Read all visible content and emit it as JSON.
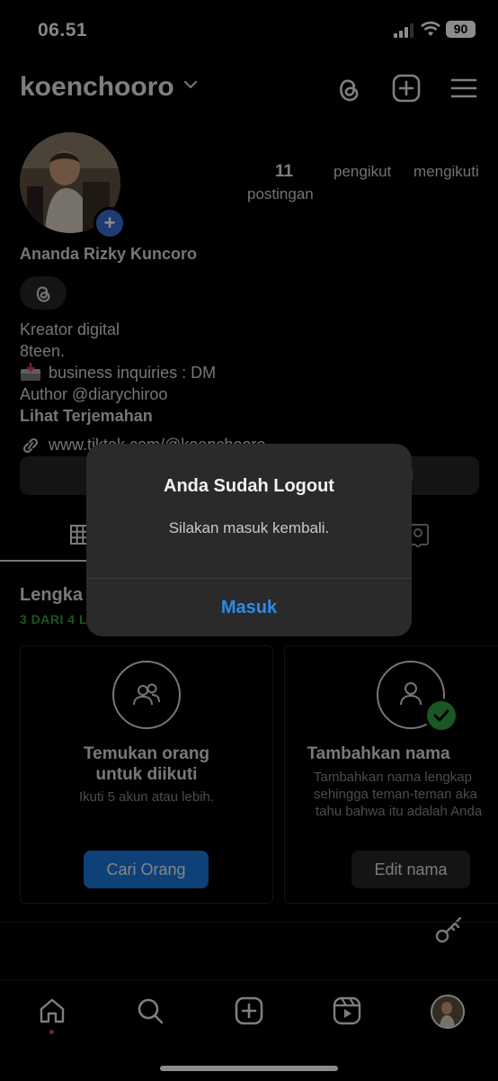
{
  "status_bar": {
    "time": "06.51",
    "battery": "90"
  },
  "header": {
    "username": "koenchooro"
  },
  "profile": {
    "posts_count": "11",
    "posts_label": "postingan",
    "followers_label": "pengikut",
    "following_label": "mengikuti",
    "full_name": "Ananda Rizky Kuncoro",
    "bio_lines": [
      "Kreator digital",
      "8teen.",
      "business inquiries : DM",
      "Author @diarychiroo"
    ],
    "translate_label": "Lihat Terjemahan",
    "link": "www.tiktok.com/@koenchooro",
    "right_button_partial": "il"
  },
  "complete_profile": {
    "title_partial": "Lengka",
    "progress_partial": "3 DARI 4 L",
    "cards": [
      {
        "icon": "people-icon",
        "title_line1": "Temukan orang",
        "title_line2": "untuk diikuti",
        "subtitle": "Ikuti 5 akun atau lebih.",
        "button": "Cari Orang"
      },
      {
        "icon": "person-icon",
        "title": "Tambahkan nama",
        "subtitle_lines": [
          "Tambahkan nama lengkap",
          "sehingga teman-teman aka",
          "tahu bahwa itu adalah Anda"
        ],
        "button": "Edit nama"
      }
    ]
  },
  "dialog": {
    "title": "Anda Sudah Logout",
    "message": "Silakan masuk kembali.",
    "button": "Masuk"
  },
  "colors": {
    "background": "#000000",
    "dialog_bg": "#2a2a2a",
    "link_blue": "#2b8bea",
    "primary_button": "#1877d9",
    "success_green": "#2e9e43",
    "notification_dot": "#e03b3b"
  },
  "nav_icons": [
    "home-icon",
    "search-icon",
    "create-icon",
    "reels-icon",
    "profile-avatar"
  ]
}
